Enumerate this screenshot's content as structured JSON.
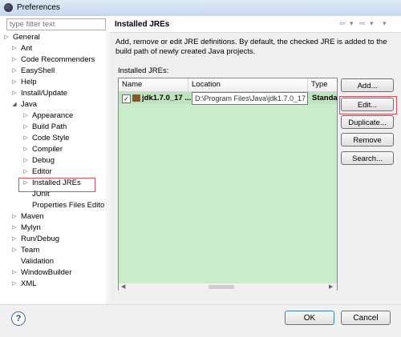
{
  "window": {
    "title": "Preferences"
  },
  "sidebar": {
    "filter_placeholder": "type filter text",
    "items": [
      {
        "label": "General"
      },
      {
        "label": "Ant"
      },
      {
        "label": "Code Recommenders"
      },
      {
        "label": "EasyShell"
      },
      {
        "label": "Help"
      },
      {
        "label": "Install/Update"
      },
      {
        "label": "Java"
      },
      {
        "label": "Appearance"
      },
      {
        "label": "Build Path"
      },
      {
        "label": "Code Style"
      },
      {
        "label": "Compiler"
      },
      {
        "label": "Debug"
      },
      {
        "label": "Editor"
      },
      {
        "label": "Installed JREs"
      },
      {
        "label": "JUnit"
      },
      {
        "label": "Properties Files Edito"
      },
      {
        "label": "Maven"
      },
      {
        "label": "Mylyn"
      },
      {
        "label": "Run/Debug"
      },
      {
        "label": "Team"
      },
      {
        "label": "Validation"
      },
      {
        "label": "WindowBuilder"
      },
      {
        "label": "XML"
      }
    ]
  },
  "page": {
    "title": "Installed JREs",
    "description": "Add, remove or edit JRE definitions. By default, the checked JRE is added to the build path of newly created Java projects.",
    "list_label": "Installed JREs:",
    "columns": [
      "Name",
      "Location",
      "Type"
    ],
    "rows": [
      {
        "checked": true,
        "name": "jdk1.7.0_17 ...",
        "location": "D:\\Program Files\\Java\\jdk1.7.0_17",
        "type": "Standa"
      }
    ],
    "buttons": {
      "add": "Add...",
      "edit": "Edit...",
      "duplicate": "Duplicate...",
      "remove": "Remove",
      "search": "Search..."
    }
  },
  "footer": {
    "help": "?",
    "ok": "OK",
    "cancel": "Cancel"
  }
}
